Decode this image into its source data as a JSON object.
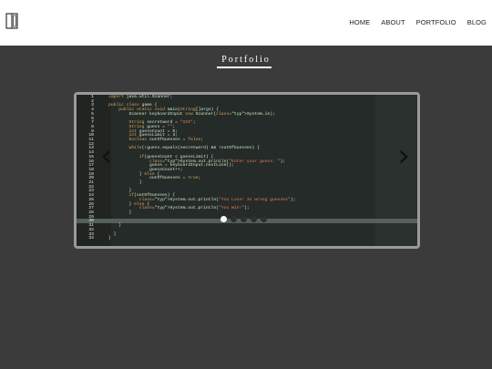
{
  "nav": {
    "items": [
      "HOME",
      "ABOUT",
      "PORTFOLIO",
      "BLOG"
    ]
  },
  "portfolio": {
    "title": "Portfolio"
  },
  "carousel": {
    "slide_count": 5,
    "active_index": 0,
    "code_lines": [
      "import java.util.Scanner;",
      "",
      "public class game {",
      "    public static void main(String[]args) {",
      "        Scanner keyboardInput new Scanner(System.in);",
      "",
      "        String secretword = \"XXX\";",
      "        String guess = \"\";",
      "        int guessCount = 0;",
      "        int guessLimit = 3;",
      "        boolean outOfGuesses = false;",
      "",
      "        while(!guess.equals(secretword) && !outOfGuesses) {",
      "",
      "            if(guessCount < guessLimit) {",
      "                System.out.println(\"Enter your guess: \");",
      "                guess = keyboardInput.nextLine();",
      "                guessCount++;",
      "            } else {",
      "                outOfGuesses = true;",
      "            }",
      "",
      "        }",
      "        if(outOfGuesses) {",
      "            System.out.println(\"You Lose! 3x wrong guesses\");",
      "        } else {",
      "            System.out.println(\"You Win!\");",
      "        }",
      "",
      "",
      "    }",
      "",
      "  }",
      "}"
    ]
  }
}
